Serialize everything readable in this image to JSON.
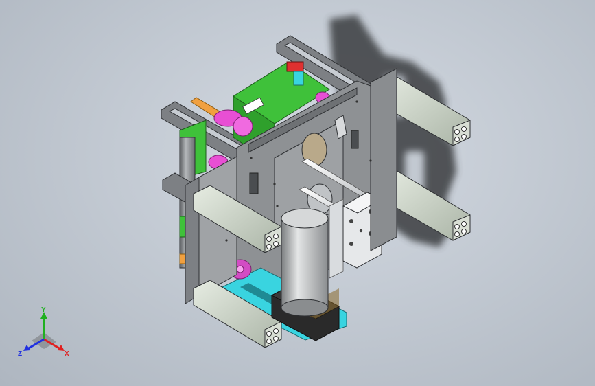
{
  "viewport": {
    "background_top": "#d4dae2",
    "background_bottom": "#aeb6c0"
  },
  "model": {
    "parts": [
      "aluminum-extrusion-frame",
      "side-plate",
      "stepper-motor",
      "cylindrical-motor",
      "linear-guide-rods",
      "slider-block",
      "green-bracket",
      "magenta-bushings",
      "cyan-base-plate",
      "top-handle-brackets"
    ],
    "colors": {
      "frame_gray": "#7d8084",
      "extrusion": "#c9d2c6",
      "green": "#3fc13a",
      "magenta": "#e84fd4",
      "cyan": "#39d4e0",
      "orange": "#f0a040",
      "motor_silver": "#b9bcbd",
      "stepper_black": "#2a2a2a",
      "red": "#e03030",
      "shadow": "#3a3d40"
    }
  },
  "triad": {
    "x_label": "X",
    "y_label": "Y",
    "z_label": "Z",
    "x_color": "#e02020",
    "y_color": "#20b020",
    "z_color": "#2030e0",
    "icon": "coordinate-triad-icon"
  }
}
